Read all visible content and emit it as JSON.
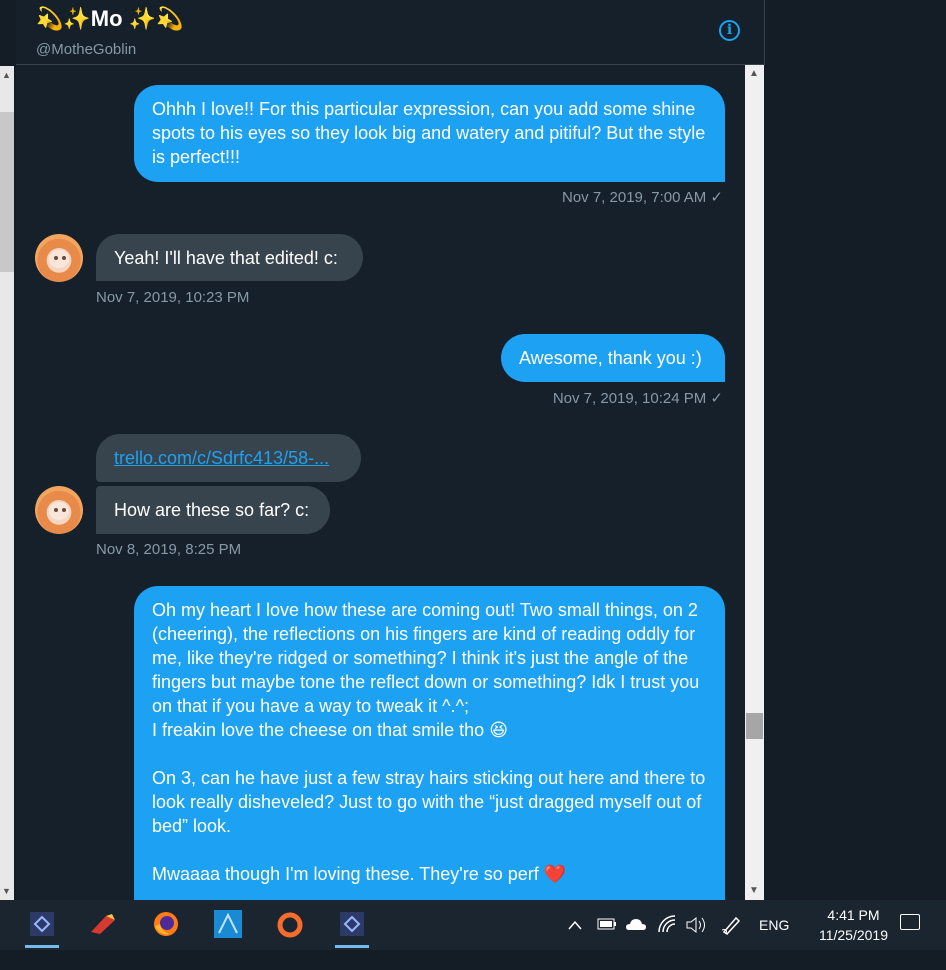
{
  "header": {
    "name": "💫✨Mo ✨💫",
    "handle": "@MotheGoblin",
    "info_icon": "i"
  },
  "messages": [
    {
      "dir": "out",
      "text": "Ohhh I love!! For this particular expression, can you add some shine spots to his eyes so they look big and watery and pitiful? But the style is perfect!!!",
      "timestamp": "Nov 7, 2019, 7:00 AM ✓"
    },
    {
      "dir": "in",
      "text": "Yeah! I'll have that edited! c:",
      "timestamp": "Nov 7, 2019, 10:23 PM"
    },
    {
      "dir": "out",
      "text": "Awesome, thank you :)",
      "timestamp": "Nov 7, 2019, 10:24 PM ✓"
    },
    {
      "dir": "in",
      "link": "trello.com/c/Sdrfc413/58-...",
      "text": "How are these so far? c:",
      "timestamp": "Nov 8, 2019, 8:25 PM"
    },
    {
      "dir": "out",
      "lines": [
        "Oh my heart I love how these are coming out! Two small things, on 2 (cheering), the reflections on his fingers are kind of reading oddly for me, like they're ridged or something? I think it's just the angle of the fingers but maybe tone the reflect down or something? Idk I trust you on that if you have a way to tweak it ^.^;",
        "I freakin love the cheese on that smile tho 😆",
        "",
        "On 3, can he have just a few stray hairs sticking out here and there to look really disheveled? Just to go with the “just dragged myself out of bed” look.",
        "",
        "Mwaaaa though I'm loving these. They're so perf ❤️"
      ]
    }
  ],
  "taskbar": {
    "apps": [
      "visual-studio-icon",
      "paint-icon",
      "firefox-icon",
      "affinity-designer-icon",
      "origin-icon",
      "visual-studio-icon-2"
    ],
    "language": "ENG",
    "time": "4:41 PM",
    "date": "11/25/2019"
  }
}
